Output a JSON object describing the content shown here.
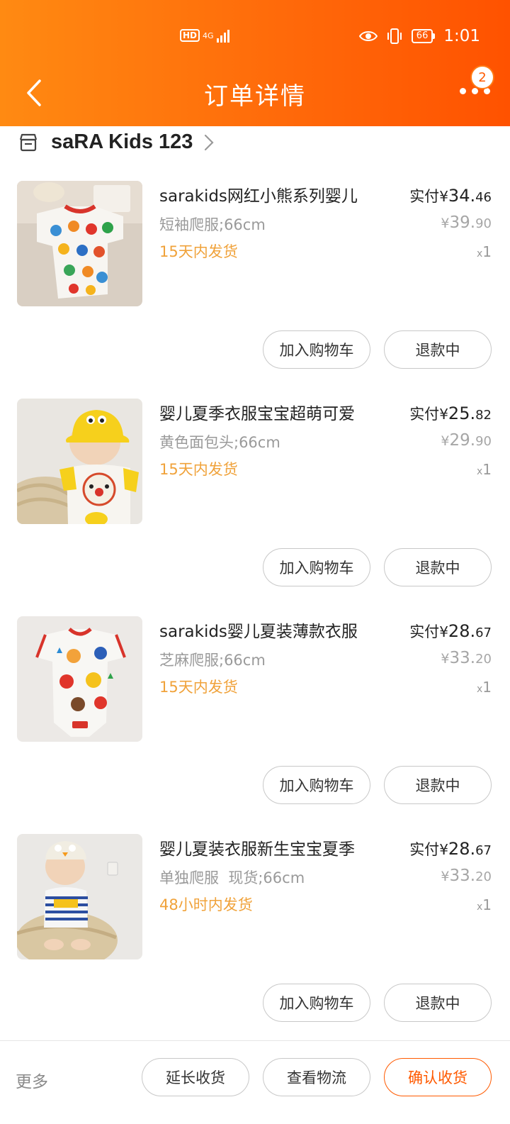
{
  "status_bar": {
    "network_badge": "HD",
    "network_type": "4G",
    "battery": "66",
    "time": "1:01"
  },
  "header": {
    "title": "订单详情",
    "badge_count": "2"
  },
  "shop": {
    "name": "saRA Kids 123"
  },
  "items": [
    {
      "title": "sarakids网红小熊系列婴儿",
      "spec": "短袖爬服;66cm",
      "shipping": "15天内发货",
      "paid_label": "实付",
      "paid_yen": "¥",
      "paid_int": "34.",
      "paid_dec": "46",
      "orig_yen": "¥",
      "orig_int": "39.",
      "orig_dec": "90",
      "qty_x": "x",
      "qty": "1",
      "cart_label": "加入购物车",
      "refund_label": "退款中"
    },
    {
      "title": "婴儿夏季衣服宝宝超萌可爱",
      "spec": "黄色面包头;66cm",
      "shipping": "15天内发货",
      "paid_label": "实付",
      "paid_yen": "¥",
      "paid_int": "25.",
      "paid_dec": "82",
      "orig_yen": "¥",
      "orig_int": "29.",
      "orig_dec": "90",
      "qty_x": "x",
      "qty": "1",
      "cart_label": "加入购物车",
      "refund_label": "退款中"
    },
    {
      "title": "sarakids婴儿夏装薄款衣服",
      "spec": "芝麻爬服;66cm",
      "shipping": "15天内发货",
      "paid_label": "实付",
      "paid_yen": "¥",
      "paid_int": "28.",
      "paid_dec": "67",
      "orig_yen": "¥",
      "orig_int": "33.",
      "orig_dec": "20",
      "qty_x": "x",
      "qty": "1",
      "cart_label": "加入购物车",
      "refund_label": "退款中"
    },
    {
      "title": "婴儿夏装衣服新生宝宝夏季",
      "spec": "单独爬服  现货;66cm",
      "shipping": "48小时内发货",
      "paid_label": "实付",
      "paid_yen": "¥",
      "paid_int": "28.",
      "paid_dec": "67",
      "orig_yen": "¥",
      "orig_int": "33.",
      "orig_dec": "20",
      "qty_x": "x",
      "qty": "1",
      "cart_label": "加入购物车",
      "refund_label": "退款中"
    }
  ],
  "bottom_bar": {
    "more_label": "更多",
    "extend_label": "延长收货",
    "logistics_label": "查看物流",
    "confirm_label": "确认收货"
  },
  "colors": {
    "brand_orange": "#ff6a0a",
    "shipping_text": "#f0a23a",
    "confirm_button": "#ff5a00"
  }
}
